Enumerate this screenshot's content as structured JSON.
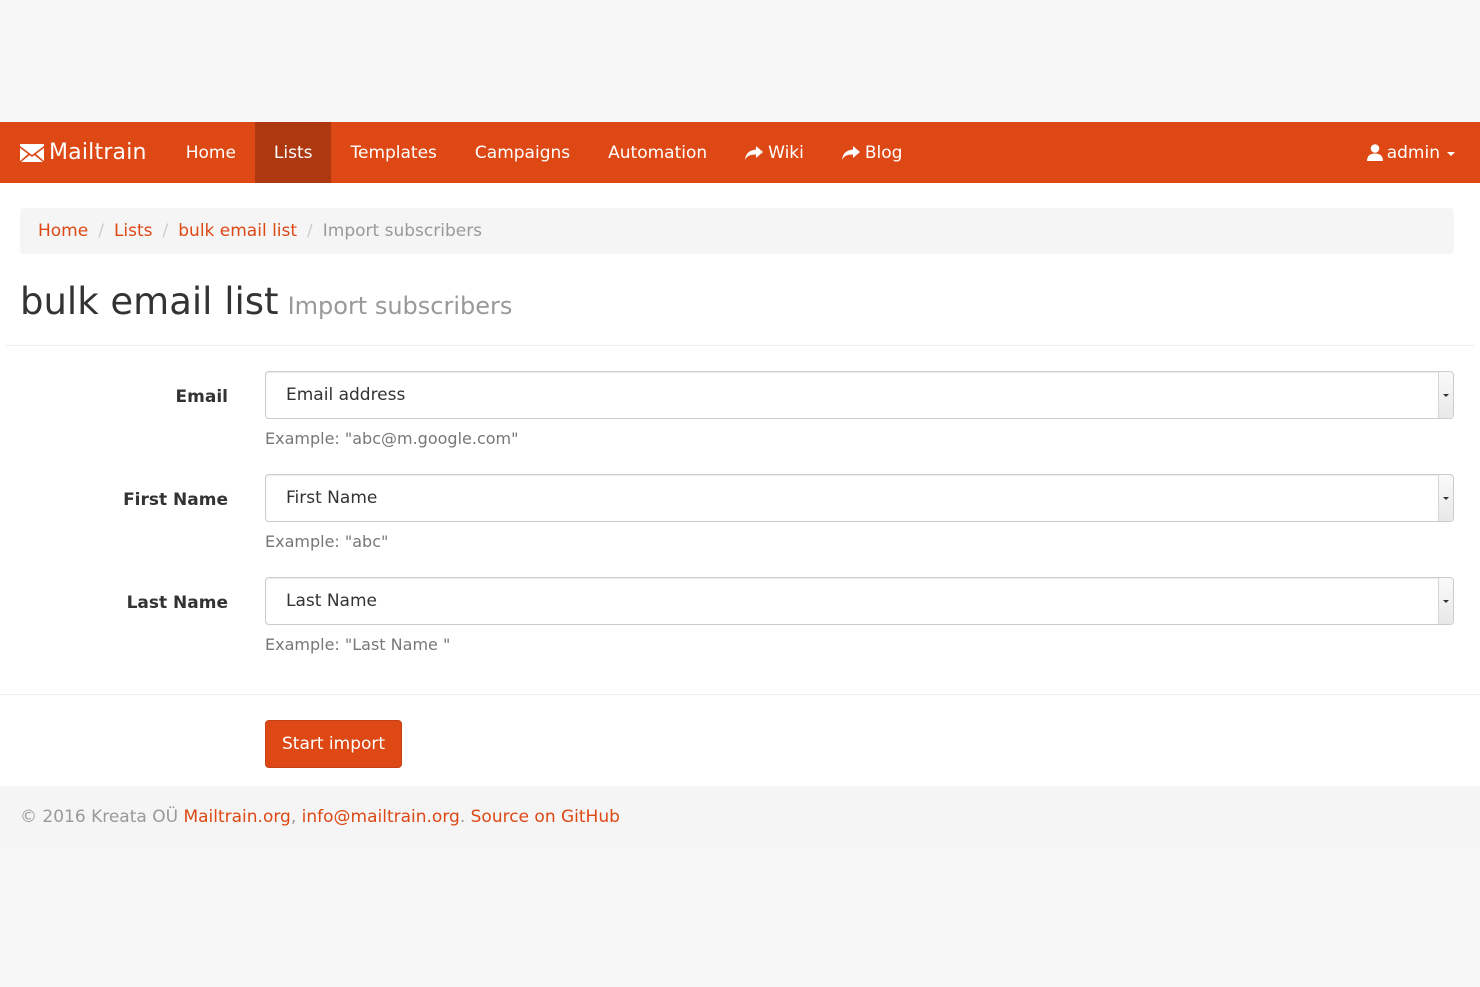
{
  "navbar": {
    "brand": "Mailtrain",
    "items": [
      {
        "label": "Home",
        "active": false
      },
      {
        "label": "Lists",
        "active": true
      },
      {
        "label": "Templates",
        "active": false
      },
      {
        "label": "Campaigns",
        "active": false
      },
      {
        "label": "Automation",
        "active": false
      },
      {
        "label": "Wiki",
        "icon": "share-arrow-icon"
      },
      {
        "label": "Blog",
        "icon": "share-arrow-icon"
      }
    ],
    "user": "admin"
  },
  "breadcrumb": {
    "items": [
      "Home",
      "Lists",
      "bulk email list"
    ],
    "current": "Import subscribers"
  },
  "header": {
    "title": "bulk email list",
    "subtitle": "Import subscribers"
  },
  "form": {
    "fields": [
      {
        "label": "Email",
        "selected": "Email address",
        "help": "Example: \"abc@m.google.com\""
      },
      {
        "label": "First Name",
        "selected": "First Name",
        "help": "Example: \"abc\""
      },
      {
        "label": "Last Name",
        "selected": "Last Name",
        "help": "Example: \"Last Name \""
      }
    ],
    "submit_label": "Start import"
  },
  "footer": {
    "copyright": "© 2016 Kreata OÜ",
    "site_link": "Mailtrain.org",
    "comma": ",",
    "email_link": "info@mailtrain.org",
    "dot": ".",
    "github_link": "Source on GitHub"
  },
  "colors": {
    "brand": "#dd4814",
    "active_nav": "#ae3910"
  }
}
